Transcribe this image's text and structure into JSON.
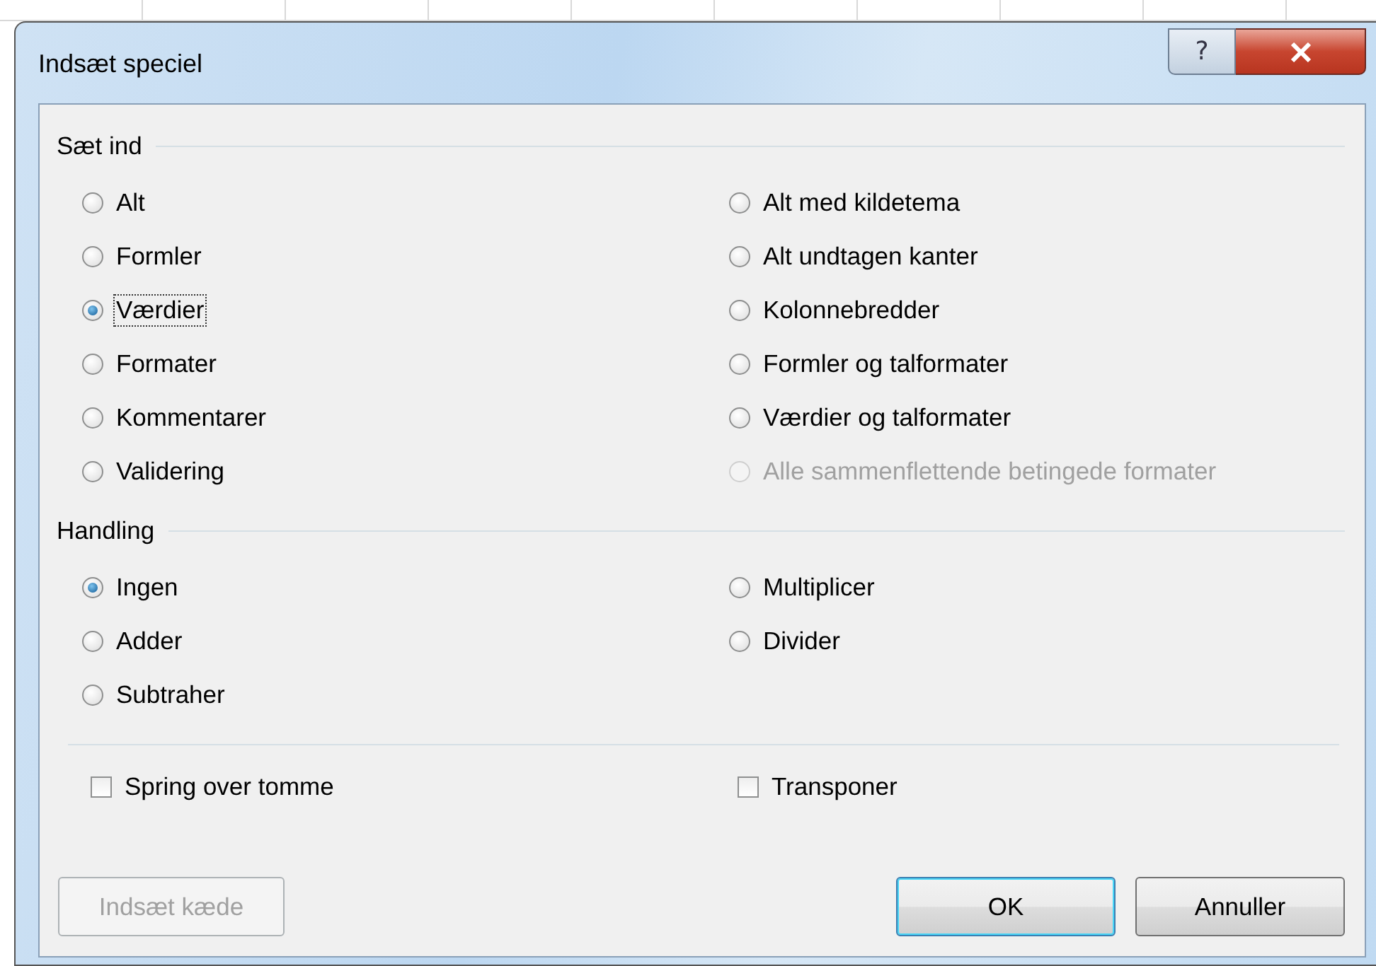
{
  "window": {
    "title": "Indsæt speciel",
    "help_label": "?"
  },
  "sections": [
    {
      "title": "Sæt ind",
      "columns": [
        [
          {
            "label": "Alt",
            "selected": false,
            "focused": false,
            "disabled": false
          },
          {
            "label": "Formler",
            "selected": false,
            "focused": false,
            "disabled": false
          },
          {
            "label": "Værdier",
            "selected": true,
            "focused": true,
            "disabled": false
          },
          {
            "label": "Formater",
            "selected": false,
            "focused": false,
            "disabled": false
          },
          {
            "label": "Kommentarer",
            "selected": false,
            "focused": false,
            "disabled": false
          },
          {
            "label": "Validering",
            "selected": false,
            "focused": false,
            "disabled": false
          }
        ],
        [
          {
            "label": "Alt med kildetema",
            "selected": false,
            "focused": false,
            "disabled": false
          },
          {
            "label": "Alt undtagen kanter",
            "selected": false,
            "focused": false,
            "disabled": false
          },
          {
            "label": "Kolonnebredder",
            "selected": false,
            "focused": false,
            "disabled": false
          },
          {
            "label": "Formler og talformater",
            "selected": false,
            "focused": false,
            "disabled": false
          },
          {
            "label": "Værdier og talformater",
            "selected": false,
            "focused": false,
            "disabled": false
          },
          {
            "label": "Alle sammenflettende betingede formater",
            "selected": false,
            "focused": false,
            "disabled": true
          }
        ]
      ]
    },
    {
      "title": "Handling",
      "columns": [
        [
          {
            "label": "Ingen",
            "selected": true,
            "focused": false,
            "disabled": false
          },
          {
            "label": "Adder",
            "selected": false,
            "focused": false,
            "disabled": false
          },
          {
            "label": "Subtraher",
            "selected": false,
            "focused": false,
            "disabled": false
          }
        ],
        [
          {
            "label": "Multiplicer",
            "selected": false,
            "focused": false,
            "disabled": false
          },
          {
            "label": "Divider",
            "selected": false,
            "focused": false,
            "disabled": false
          }
        ]
      ]
    }
  ],
  "checkboxes": [
    {
      "label": "Spring over tomme",
      "checked": false
    },
    {
      "label": "Transponer",
      "checked": false
    }
  ],
  "buttons": [
    {
      "label": "Indsæt kæde",
      "disabled": true,
      "default": false
    },
    {
      "label": "OK",
      "disabled": false,
      "default": true
    },
    {
      "label": "Annuller",
      "disabled": false,
      "default": false
    }
  ]
}
